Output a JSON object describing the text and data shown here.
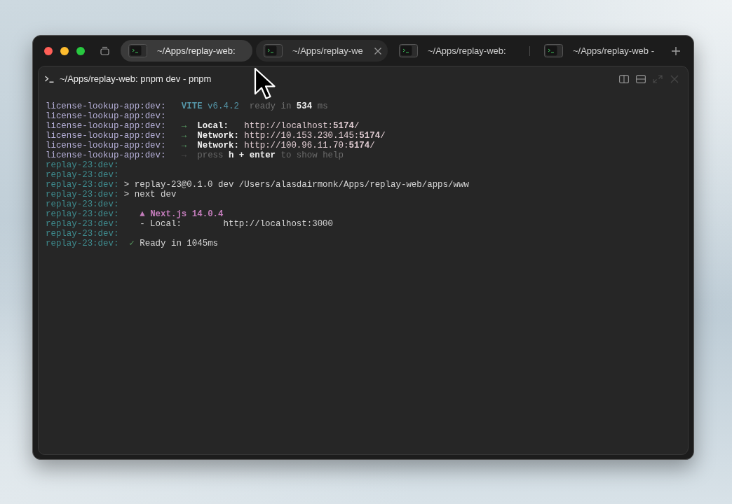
{
  "tabs": [
    {
      "title": "~/Apps/replay-web:",
      "selected": true,
      "hovered": false
    },
    {
      "title": "~/Apps/replay-we",
      "selected": false,
      "hovered": true
    },
    {
      "title": "~/Apps/replay-web:",
      "selected": false,
      "hovered": false
    },
    {
      "title": "~/Apps/replay-web -",
      "selected": false,
      "hovered": false
    }
  ],
  "pane": {
    "title": "~/Apps/replay-web: pnpm dev - pnpm",
    "actions": [
      {
        "kind": "columns",
        "disabled": false
      },
      {
        "kind": "rows",
        "disabled": false
      },
      {
        "kind": "expand",
        "disabled": true
      },
      {
        "kind": "close",
        "disabled": true
      }
    ]
  },
  "terminal": {
    "lines": [
      {
        "prefix": "license-lookup-app:dev:",
        "color": "#b7b1da",
        "segments": [
          {
            "kind": "banner",
            "text": "   **VITE** v6.4.2"
          },
          {
            "kind": "timing",
            "text": "  ready in **534** ms"
          }
        ]
      },
      {
        "prefix": "license-lookup-app:dev:",
        "color": "#b7b1da"
      },
      {
        "prefix": "license-lookup-app:dev:",
        "color": "#b7b1da",
        "segments": [
          {
            "kind": "arrow",
            "text": "   →"
          },
          {
            "kind": "label",
            "text": "  Local:"
          },
          {
            "kind": "url",
            "text": "   http://localhost:**5174**/"
          }
        ]
      },
      {
        "prefix": "license-lookup-app:dev:",
        "color": "#b7b1da",
        "segments": [
          {
            "kind": "arrow",
            "text": "   →"
          },
          {
            "kind": "label",
            "text": "  Network:"
          },
          {
            "kind": "url",
            "text": " http://10.153.230.145:**5174**/"
          }
        ]
      },
      {
        "prefix": "license-lookup-app:dev:",
        "color": "#b7b1da",
        "segments": [
          {
            "kind": "arrow",
            "text": "   →"
          },
          {
            "kind": "label",
            "text": "  Network:"
          },
          {
            "kind": "url",
            "text": " http://100.96.11.70:**5174**/"
          }
        ]
      },
      {
        "prefix": "license-lookup-app:dev:",
        "color": "#b7b1da",
        "segments": [
          {
            "kind": "bullet",
            "text": "   →"
          },
          {
            "kind": "hint",
            "text": "  press **h + enter** to show help"
          }
        ]
      },
      {
        "prefix": "replay-23:dev:",
        "color": "#3e8b8e"
      },
      {
        "prefix": "replay-23:dev:",
        "color": "#3e8b8e"
      },
      {
        "prefix": "replay-23:dev:",
        "color": "#3e8b8e",
        "segments": [
          {
            "kind": "command",
            "text": " > replay-23@0.1.0 dev /Users/alasdairmonk/Apps/replay-web/apps/www"
          }
        ]
      },
      {
        "prefix": "replay-23:dev:",
        "color": "#3e8b8e",
        "segments": [
          {
            "kind": "command",
            "text": " > next dev"
          }
        ]
      },
      {
        "prefix": "replay-23:dev:",
        "color": "#3e8b8e"
      },
      {
        "prefix": "replay-23:dev:",
        "color": "#3e8b8e",
        "segments": [
          {
            "kind": "logo",
            "text": "    ▲"
          },
          {
            "kind": "heading",
            "text": " Next.js 14.0.4"
          }
        ]
      },
      {
        "prefix": "replay-23:dev:",
        "color": "#3e8b8e",
        "segments": [
          {
            "kind": "text",
            "text": "    - Local:"
          },
          {
            "kind": "text",
            "text": "        http://localhost:3000"
          }
        ]
      },
      {
        "prefix": "replay-23:dev:",
        "color": "#3e8b8e"
      },
      {
        "prefix": "replay-23:dev:",
        "color": "#3e8b8e",
        "segments": [
          {
            "kind": "check",
            "text": "  ✓"
          },
          {
            "kind": "text",
            "text": " Ready in 1045ms"
          }
        ]
      }
    ]
  }
}
